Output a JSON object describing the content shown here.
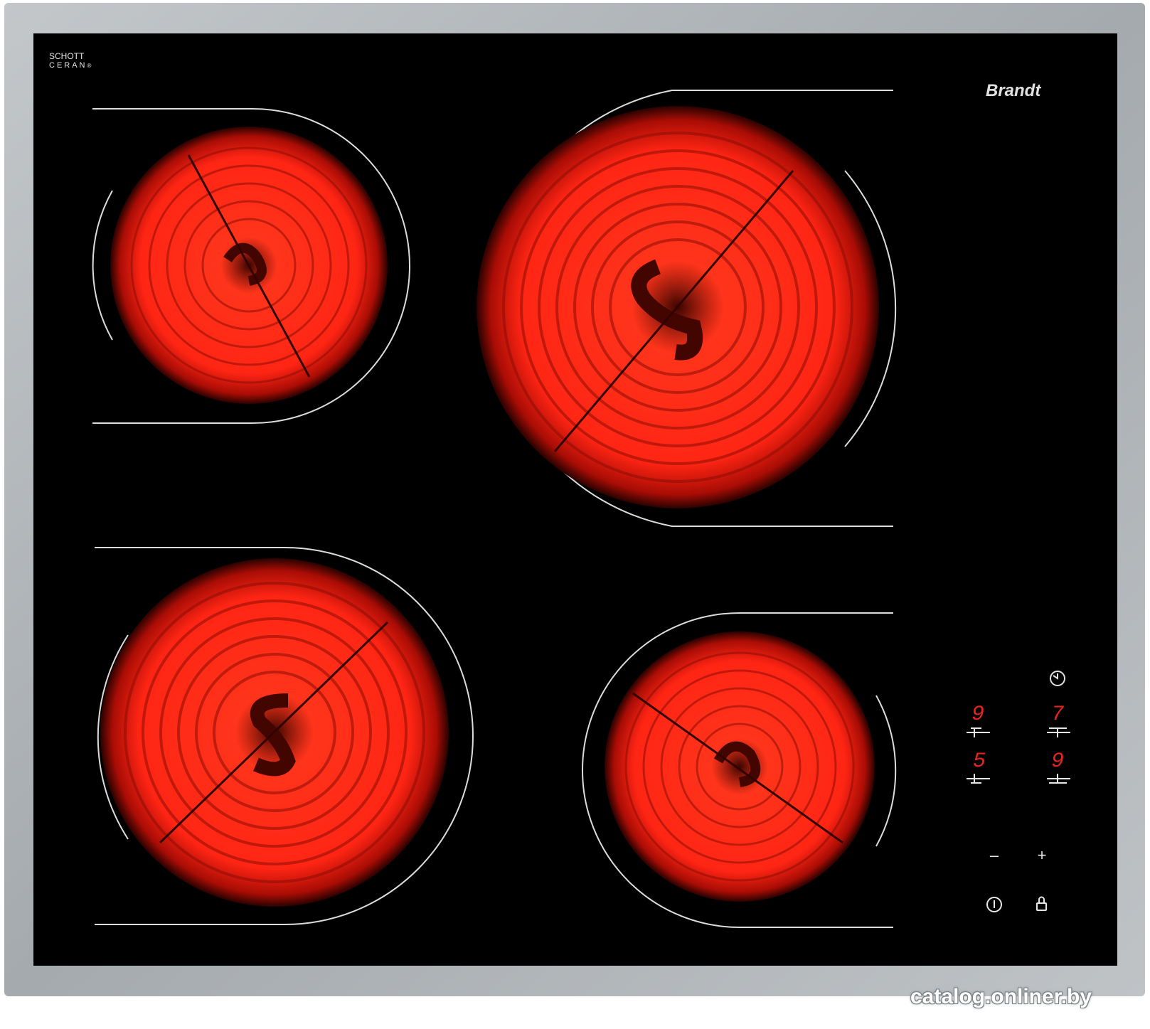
{
  "brand": {
    "logo_text": "Brandt",
    "glass_mark_line1": "SCHOTT",
    "glass_mark_line2": "CERAN",
    "glass_mark_symbol": "®"
  },
  "zones": [
    {
      "position": "rear-left",
      "state": "glowing"
    },
    {
      "position": "rear-right",
      "state": "glowing"
    },
    {
      "position": "front-left",
      "state": "glowing"
    },
    {
      "position": "front-right",
      "state": "glowing"
    }
  ],
  "controls": {
    "displays": [
      {
        "value": "9",
        "zone": "rear-left"
      },
      {
        "value": "7",
        "zone": "rear-right"
      },
      {
        "value": "5",
        "zone": "front-left"
      },
      {
        "value": "9",
        "zone": "front-right"
      }
    ],
    "minus_label": "–",
    "plus_label": "+",
    "timer_icon": "clock-icon",
    "power_icon": "power-icon",
    "lock_icon": "lock-icon"
  },
  "colors": {
    "frame": "#a9aeb2",
    "glass": "#000000",
    "heat": "#ff2a17",
    "display": "#e8231c",
    "line": "#d9d9d9"
  },
  "watermark": "catalog.onliner.by"
}
